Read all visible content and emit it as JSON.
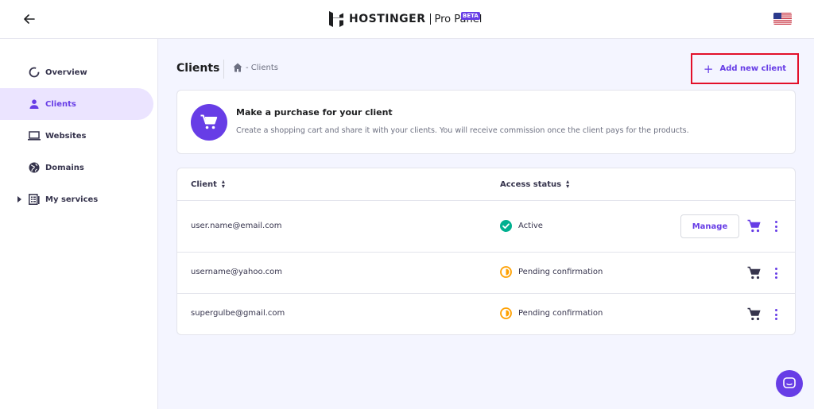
{
  "header": {
    "brand_name": "HOSTINGER",
    "brand_sub": "Pro Panel",
    "beta": "BETA"
  },
  "sidebar": {
    "items": [
      {
        "label": "Overview",
        "icon": "overview-icon"
      },
      {
        "label": "Clients",
        "icon": "user-icon",
        "active": true
      },
      {
        "label": "Websites",
        "icon": "laptop-icon"
      },
      {
        "label": "Domains",
        "icon": "globe-icon"
      },
      {
        "label": "My services",
        "icon": "services-icon"
      }
    ]
  },
  "page": {
    "title": "Clients",
    "breadcrumb": "- Clients",
    "add_button": "Add new client"
  },
  "promo": {
    "title": "Make a purchase for your client",
    "text": "Create a shopping cart and share it with your clients. You will receive commission once the client pays for the products."
  },
  "table": {
    "columns": [
      "Client",
      "Access status"
    ],
    "rows": [
      {
        "email": "user.name@email.com",
        "status": "Active",
        "manage": "Manage"
      },
      {
        "email": "username@yahoo.com",
        "status": "Pending confirmation"
      },
      {
        "email": "supergulbe@gmail.com",
        "status": "Pending confirmation"
      }
    ]
  },
  "colors": {
    "accent": "#673de6",
    "active_status": "#00b090",
    "pending_status": "#ffa000",
    "highlight_border": "#e3102a"
  }
}
